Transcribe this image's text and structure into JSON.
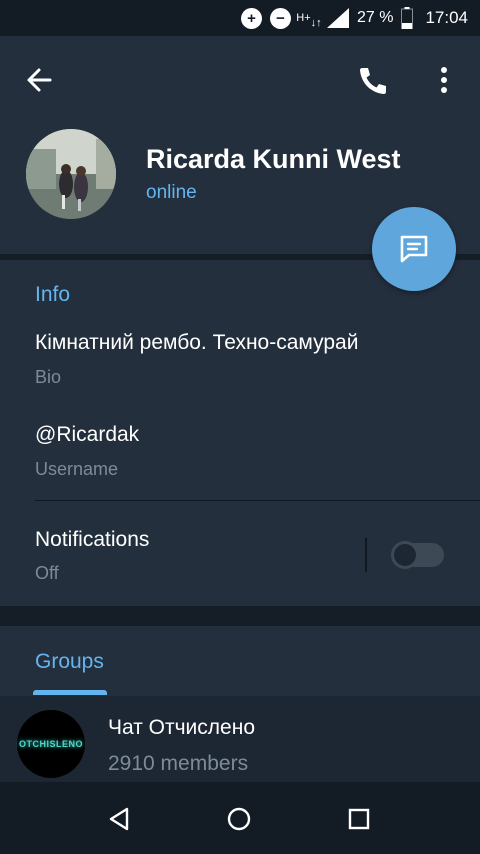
{
  "status_bar": {
    "battery": "27 %",
    "time": "17:04",
    "network": "H+",
    "icons": [
      "data-saver-icon",
      "do-not-disturb-icon",
      "network-hplus-icon",
      "signal-icon",
      "battery-icon"
    ]
  },
  "header": {
    "icons": [
      "back-arrow-icon",
      "phone-icon",
      "more-vert-icon"
    ]
  },
  "profile": {
    "name": "Ricarda Kunni West",
    "status": "online"
  },
  "fab": {
    "icon": "message-icon"
  },
  "info": {
    "title": "Info",
    "bio": "Кімнатний рембо. Техно-самурай",
    "bio_label": "Bio",
    "username": "@Ricardak",
    "username_label": "Username",
    "notifications": "Notifications",
    "notifications_value": "Off",
    "notifications_enabled": false
  },
  "groups": {
    "title": "Groups",
    "items": [
      {
        "name": "Чат Отчислено",
        "members": "2910 members",
        "avatar_text": "OTCHISLENO"
      }
    ]
  },
  "nav": {
    "icons": [
      "back-triangle-icon",
      "home-circle-icon",
      "recents-square-icon"
    ]
  },
  "colors": {
    "accent": "#64b5ef",
    "fab": "#5ea6dc",
    "background": "#1d2733",
    "card": "#242f3d"
  }
}
